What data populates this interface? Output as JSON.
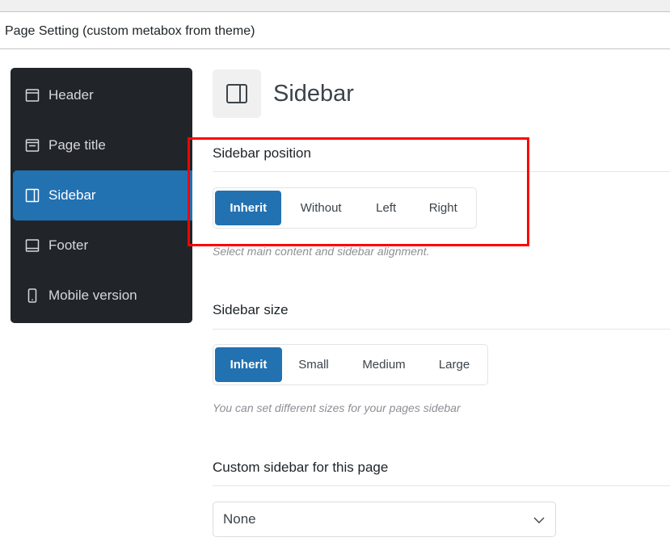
{
  "metabox": {
    "title": "Page Setting (custom metabox from theme)"
  },
  "nav": {
    "items": [
      {
        "label": "Header",
        "icon": "header-layout-icon",
        "active": false
      },
      {
        "label": "Page title",
        "icon": "page-title-layout-icon",
        "active": false
      },
      {
        "label": "Sidebar",
        "icon": "sidebar-layout-icon",
        "active": true
      },
      {
        "label": "Footer",
        "icon": "footer-layout-icon",
        "active": false
      },
      {
        "label": "Mobile version",
        "icon": "mobile-icon",
        "active": false
      }
    ]
  },
  "section": {
    "title": "Sidebar",
    "icon": "sidebar-layout-icon"
  },
  "sidebar_position": {
    "label": "Sidebar position",
    "options": [
      "Inherit",
      "Without",
      "Left",
      "Right"
    ],
    "selected": "Inherit",
    "hint": "Select main content and sidebar alignment."
  },
  "sidebar_size": {
    "label": "Sidebar size",
    "options": [
      "Inherit",
      "Small",
      "Medium",
      "Large"
    ],
    "selected": "Inherit",
    "hint": "You can set different sizes for your pages sidebar"
  },
  "custom_sidebar": {
    "label": "Custom sidebar for this page",
    "value": "None"
  },
  "colors": {
    "accent": "#2271b1",
    "nav_bg": "#212529",
    "highlight": "#ff0000"
  }
}
